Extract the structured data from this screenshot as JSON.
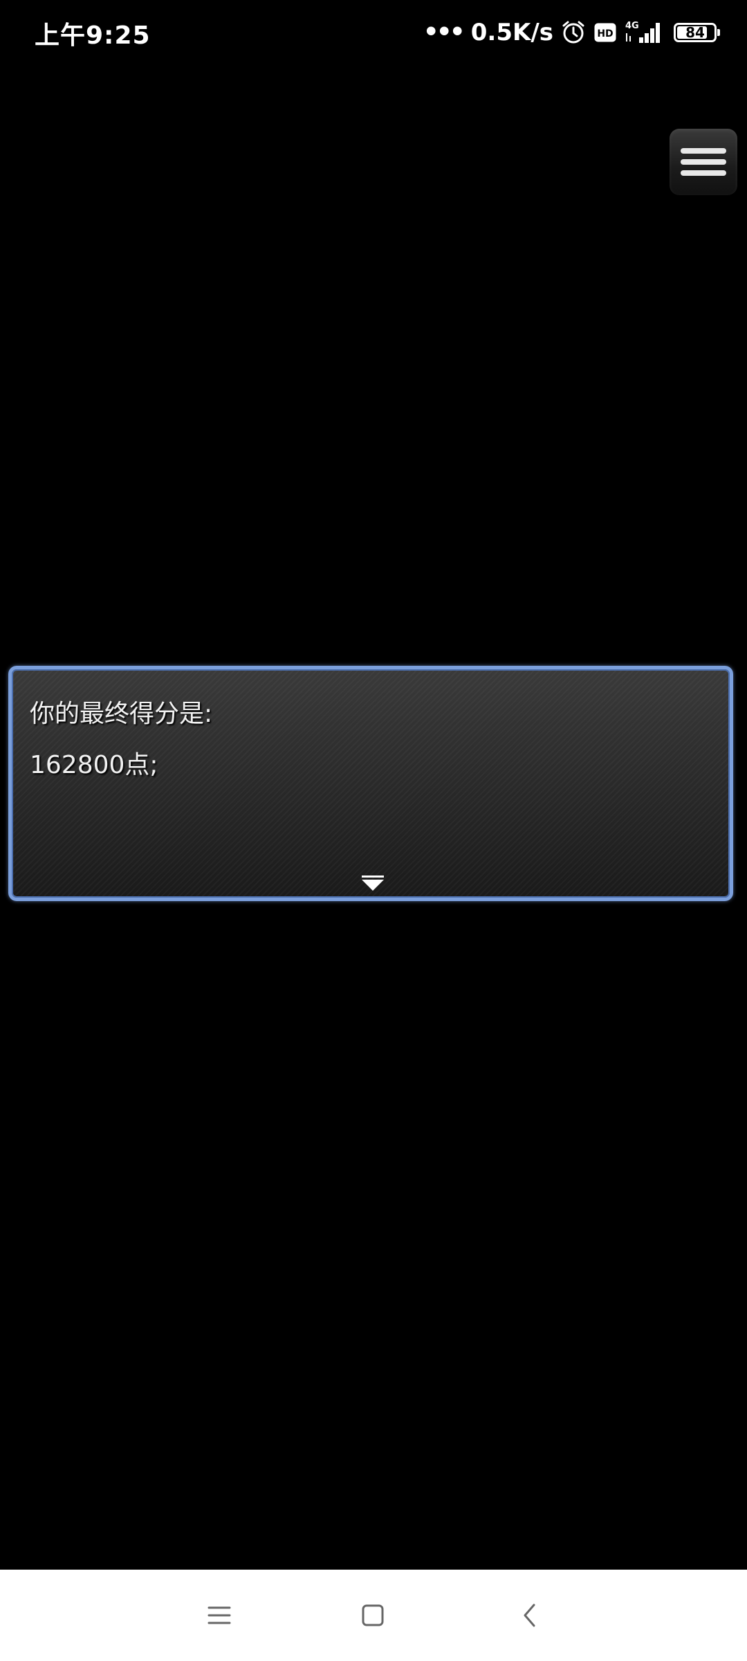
{
  "status_bar": {
    "time": "上午9:25",
    "net_dots": "•••",
    "net_speed": "0.5K/s",
    "icons": [
      "alarm-icon",
      "hd-icon",
      "4g-signal-icon",
      "battery-icon"
    ],
    "network_label": "4G",
    "hd_label": "HD",
    "battery_level": "84"
  },
  "game": {
    "menu_icon": "menu-icon",
    "message": {
      "line1": "你的最终得分是:",
      "line2": "162800点;"
    },
    "continue_icon": "down-triangle-icon",
    "window_border_color": "#7b9fdc"
  },
  "nav_bar": {
    "icons": [
      "menu-icon",
      "home-icon",
      "back-icon"
    ]
  }
}
